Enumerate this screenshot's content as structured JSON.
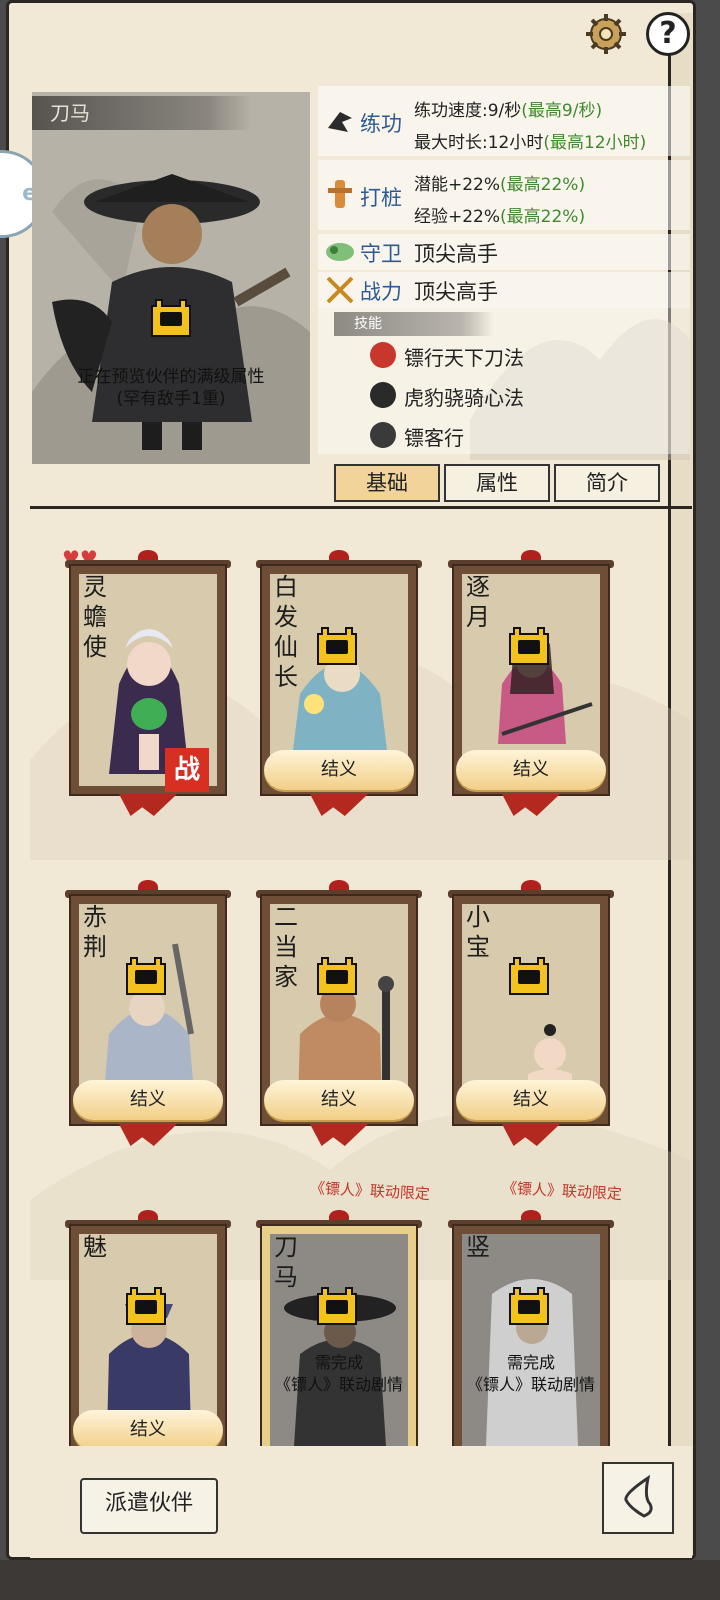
{
  "header": {
    "settings_icon": "gear-icon",
    "help_label": "?"
  },
  "side_tab": {
    "label": "e"
  },
  "portrait": {
    "name_tag": "刀马",
    "preview_line1": "正在预览伙伴的满级属性",
    "preview_line2": "(罕有敌手1重)"
  },
  "stats": {
    "practice": {
      "label": "练功",
      "speed": "练功速度:9/秒",
      "speed_max": "(最高9/秒)",
      "duration": "最大时长:12小时",
      "duration_max": "(最高12小时)"
    },
    "stake": {
      "label": "打桩",
      "potential": "潜能+22%",
      "potential_max": "(最高22%)",
      "exp": "经验+22%",
      "exp_max": "(最高22%)"
    },
    "guard": {
      "label": "守卫",
      "value": "顶尖高手"
    },
    "power": {
      "label": "战力",
      "value": "顶尖高手"
    },
    "skills_header": "技能",
    "skills": [
      "镖行天下刀法",
      "虎豹骁骑心法",
      "镖客行"
    ]
  },
  "tabs": [
    {
      "label": "基础",
      "active": true
    },
    {
      "label": "属性",
      "active": false
    },
    {
      "label": "简介",
      "active": false
    }
  ],
  "cards": [
    {
      "name": "灵蟾使",
      "button": "",
      "badge": "战",
      "hearts": "♥♥"
    },
    {
      "name": "白发仙长",
      "button": "结义"
    },
    {
      "name": "逐月",
      "button": "结义"
    },
    {
      "name": "赤荆",
      "button": "结义"
    },
    {
      "name": "二当家",
      "button": "结义"
    },
    {
      "name": "小宝",
      "button": "结义"
    },
    {
      "name": "魅",
      "button": "结义"
    },
    {
      "name": "刀马",
      "limited": "《镖人》联动限定",
      "need1": "需完成",
      "need2": "《镖人》联动剧情"
    },
    {
      "name": "竖",
      "limited": "《镖人》联动限定",
      "need1": "需完成",
      "need2": "《镖人》联动剧情"
    }
  ],
  "footer": {
    "dispatch_label": "派遣伙伴",
    "back_icon": "back-arrow-icon"
  },
  "colors": {
    "paper": "#f1e9d6",
    "frame": "#6e4e36",
    "accent_blue": "#2c5a92",
    "green": "#3f8a2e",
    "red": "#c33429",
    "button_gold": "#f1cf87"
  }
}
